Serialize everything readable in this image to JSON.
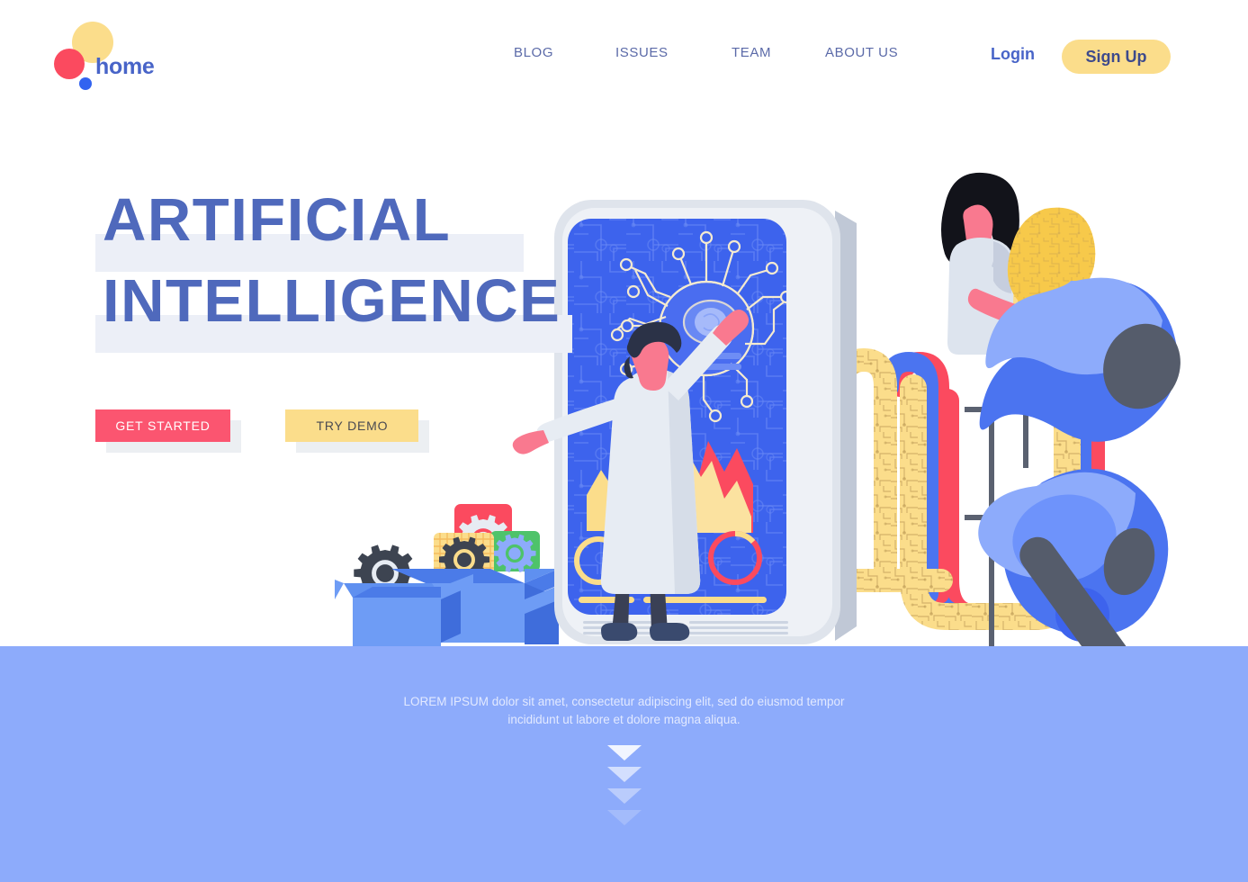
{
  "brand": {
    "name": "home",
    "logo_dots": [
      "yellow-dot",
      "red-dot",
      "blue-dot"
    ],
    "colors": {
      "yellow": "#fbdd8b",
      "red": "#fb4a5f",
      "blue": "#3263f0",
      "text": "#4864c8"
    }
  },
  "nav": {
    "items": [
      {
        "label": "BLOG"
      },
      {
        "label": "ISSUES"
      },
      {
        "label": "TEAM"
      },
      {
        "label": "ABOUT US"
      }
    ],
    "login_label": "Login",
    "signup_label": "Sign Up"
  },
  "hero": {
    "headline_line1": "ARTIFICIAL",
    "headline_line2": "INTELLIGENCE",
    "headline_color": "#4f69bc",
    "highlight_color": "#eceff7",
    "primary_cta": "GET STARTED",
    "secondary_cta": "TRY DEMO",
    "primary_cta_color": "#fb5570",
    "secondary_cta_color": "#fbdd8b"
  },
  "footer": {
    "text_line1": "LOREM IPSUM dolor sit amet, consectetur adipiscing elit, sed do eiusmod tempor",
    "text_line2": "incididunt ut labore et dolore magna aliqua.",
    "band_color": "#8dabfb",
    "scroll_arrows": 4
  },
  "illustration": {
    "scene": "ai-landing-hero",
    "elements": [
      "smartphone-device",
      "scientist-figure",
      "ai-neural-node-graphic",
      "area-chart-widget",
      "donut-chart-widget",
      "cardboard-boxes-with-gears",
      "ai-letter-u-circuit",
      "woman-figure-holding-circuit-leaf",
      "robot-arm-shapes"
    ],
    "palette": {
      "screen_blue": "#3d63ed",
      "device_grey": "#dfe4ec",
      "coat_white": "#e7ecf3",
      "skin_pink": "#f9798f",
      "hair_dark": "#2b3247",
      "chart_yellow": "#fbe2a0",
      "chart_red": "#fb4a5f",
      "box_blue": "#6e9cf5",
      "box_blue_dark": "#4b7be8",
      "gear_dark": "#3d4451",
      "robot_light": "#8dabfb",
      "robot_mid": "#4b74f0",
      "robot_dark": "#555c6b"
    }
  }
}
